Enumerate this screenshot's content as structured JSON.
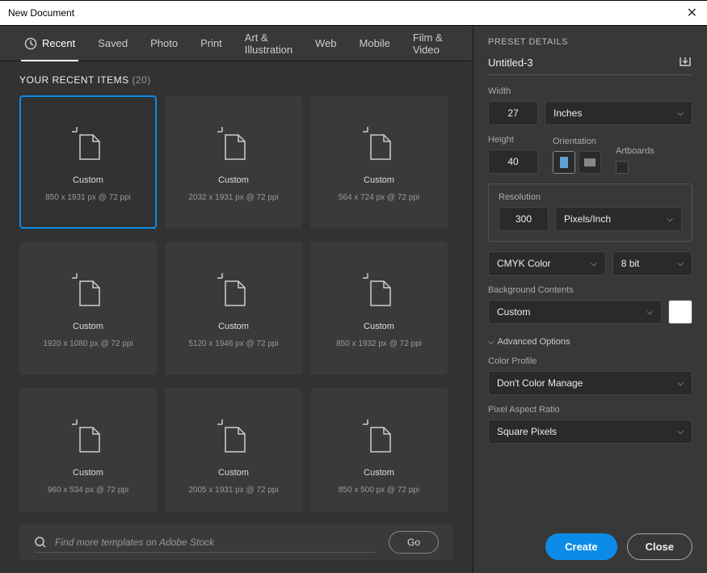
{
  "titlebar": {
    "title": "New Document"
  },
  "tabs": [
    "Recent",
    "Saved",
    "Photo",
    "Print",
    "Art & Illustration",
    "Web",
    "Mobile",
    "Film & Video"
  ],
  "section": {
    "heading": "YOUR RECENT ITEMS",
    "count": "(20)"
  },
  "cards": [
    {
      "label": "Custom",
      "sub": "850 x 1931 px @ 72 ppi"
    },
    {
      "label": "Custom",
      "sub": "2032 x 1931 px @ 72 ppi"
    },
    {
      "label": "Custom",
      "sub": "564 x 724 px @ 72 ppi"
    },
    {
      "label": "Custom",
      "sub": "1920 x 1080 px @ 72 ppi"
    },
    {
      "label": "Custom",
      "sub": "5120 x 1946 px @ 72 ppi"
    },
    {
      "label": "Custom",
      "sub": "850 x 1932 px @ 72 ppi"
    },
    {
      "label": "Custom",
      "sub": "960 x 534 px @ 72 ppi"
    },
    {
      "label": "Custom",
      "sub": "2005 x 1931 px @ 72 ppi"
    },
    {
      "label": "Custom",
      "sub": "850 x 500 px @ 72 ppi"
    }
  ],
  "search": {
    "placeholder": "Find more templates on Adobe Stock",
    "go": "Go"
  },
  "preset": {
    "header": "PRESET DETAILS",
    "docname": "Untitled-3",
    "width_label": "Width",
    "width_value": "27",
    "width_unit": "Inches",
    "height_label": "Height",
    "height_value": "40",
    "orientation_label": "Orientation",
    "artboards_label": "Artboards",
    "resolution_label": "Resolution",
    "resolution_value": "300",
    "resolution_unit": "Pixels/Inch",
    "color_mode": "CMYK Color",
    "bit_depth": "8 bit",
    "bg_label": "Background Contents",
    "bg_value": "Custom",
    "advanced": "Advanced Options",
    "profile_label": "Color Profile",
    "profile_value": "Don't Color Manage",
    "aspect_label": "Pixel Aspect Ratio",
    "aspect_value": "Square Pixels"
  },
  "buttons": {
    "create": "Create",
    "close": "Close"
  }
}
